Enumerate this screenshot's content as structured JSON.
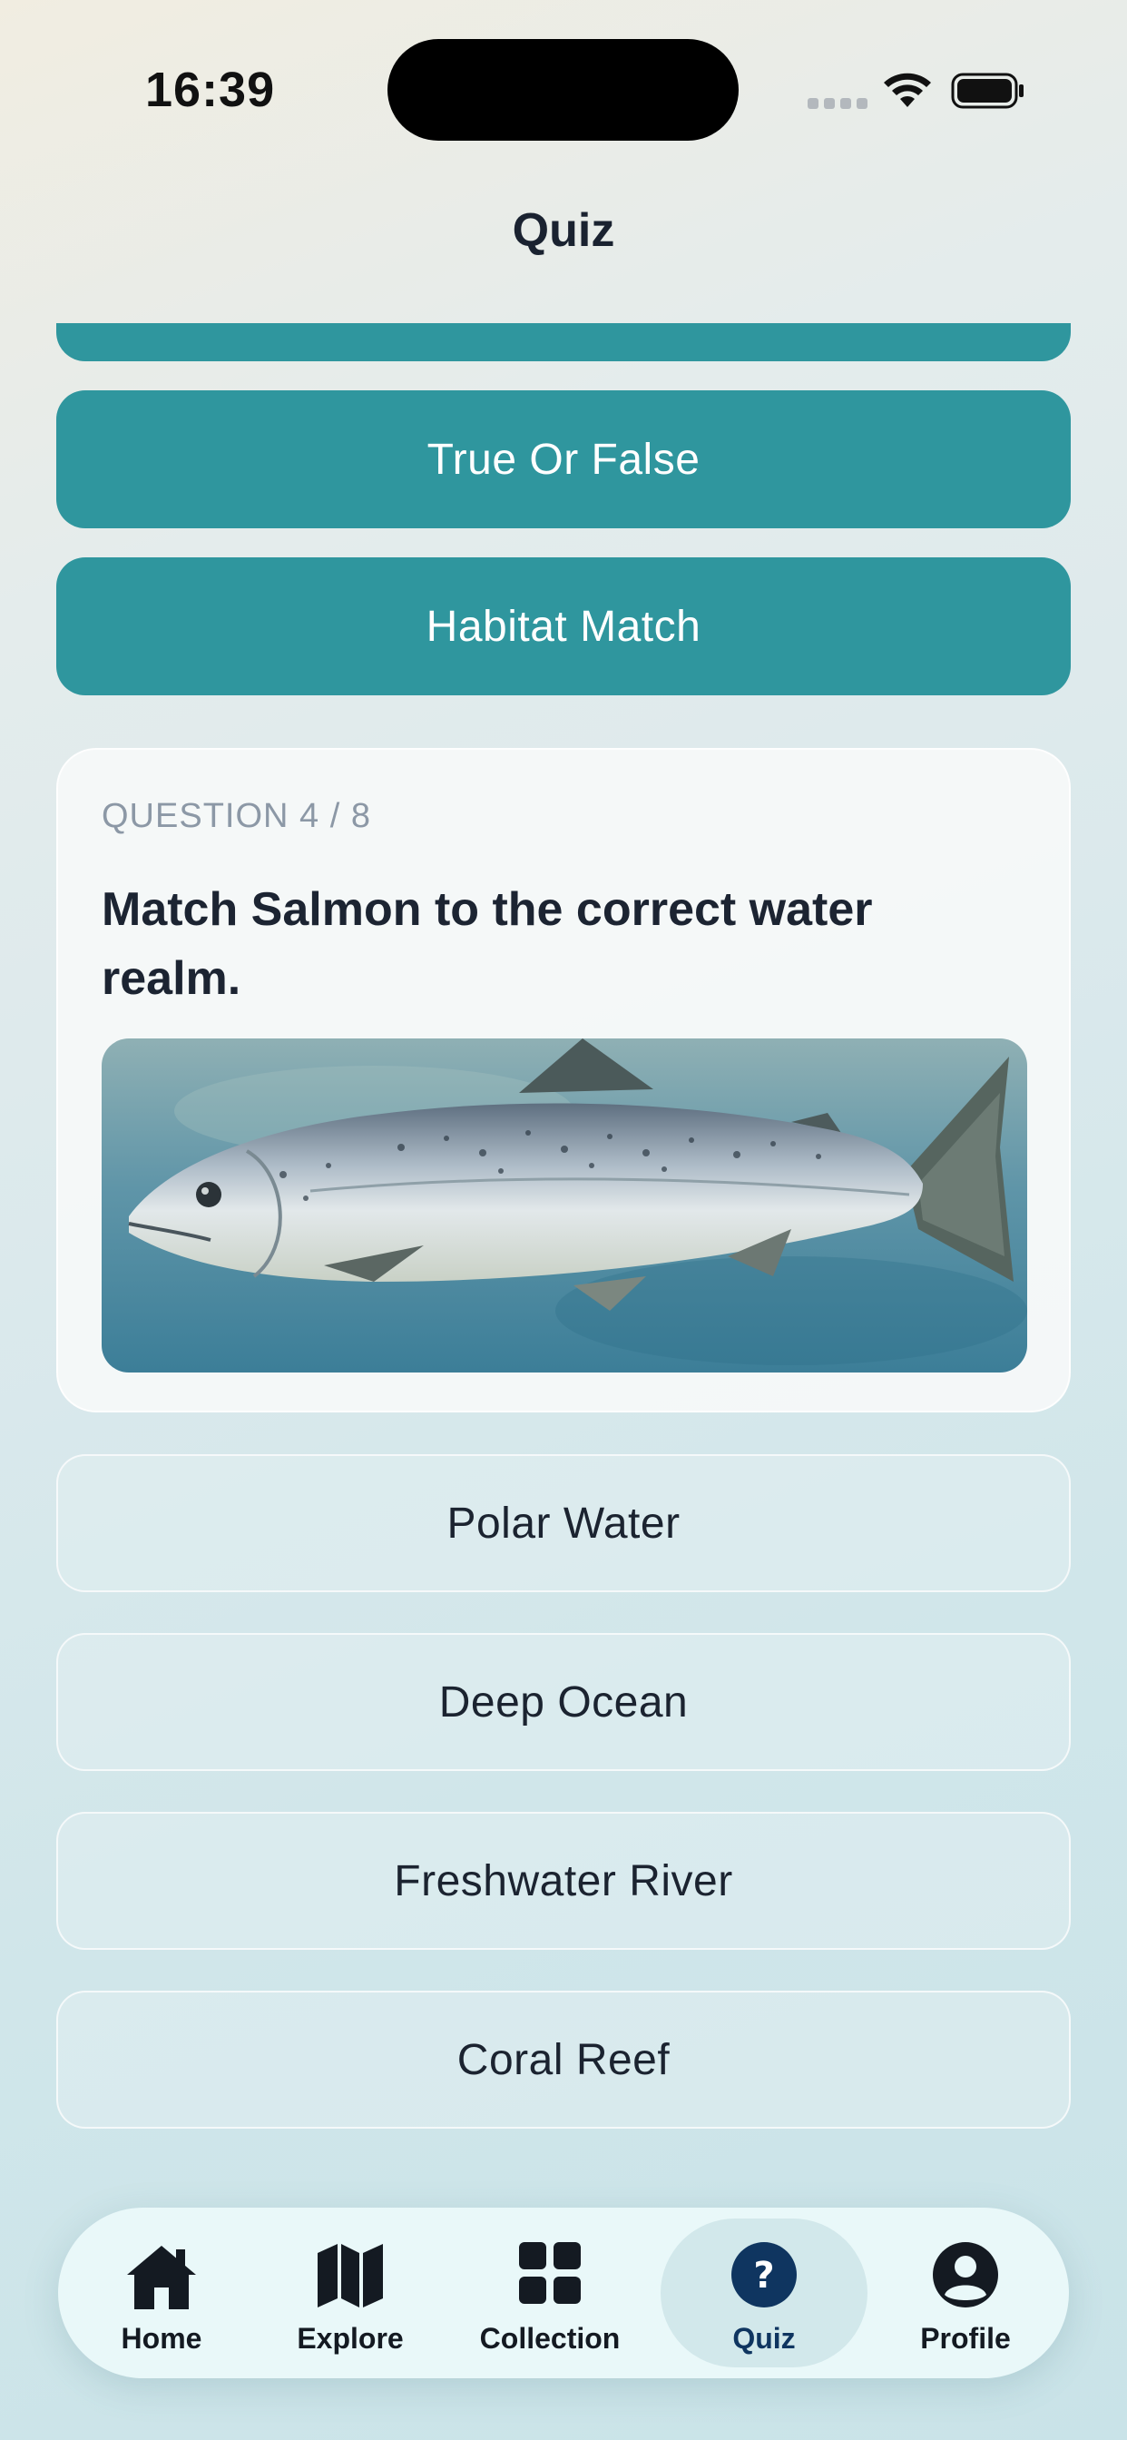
{
  "status_bar": {
    "time": "16:39"
  },
  "header": {
    "title": "Quiz"
  },
  "quiz_modes": [
    {
      "label": ""
    },
    {
      "label": "True Or False"
    },
    {
      "label": "Habitat Match"
    }
  ],
  "question": {
    "counter": "QUESTION 4 / 8",
    "text": "Match Salmon to the correct water realm.",
    "image_subject": "salmon-illustration"
  },
  "answers": [
    {
      "label": "Polar Water"
    },
    {
      "label": "Deep Ocean"
    },
    {
      "label": "Freshwater River"
    },
    {
      "label": "Coral Reef"
    }
  ],
  "tab_bar": {
    "items": [
      {
        "label": "Home",
        "icon": "home-icon"
      },
      {
        "label": "Explore",
        "icon": "map-icon"
      },
      {
        "label": "Collection",
        "icon": "grid-icon"
      },
      {
        "label": "Quiz",
        "icon": "question-icon",
        "active": true
      },
      {
        "label": "Profile",
        "icon": "person-icon"
      }
    ]
  },
  "colors": {
    "accent": "#2f969e",
    "active_tab": "#0f3560",
    "tab_bar_bg": "#e9f8f9"
  }
}
